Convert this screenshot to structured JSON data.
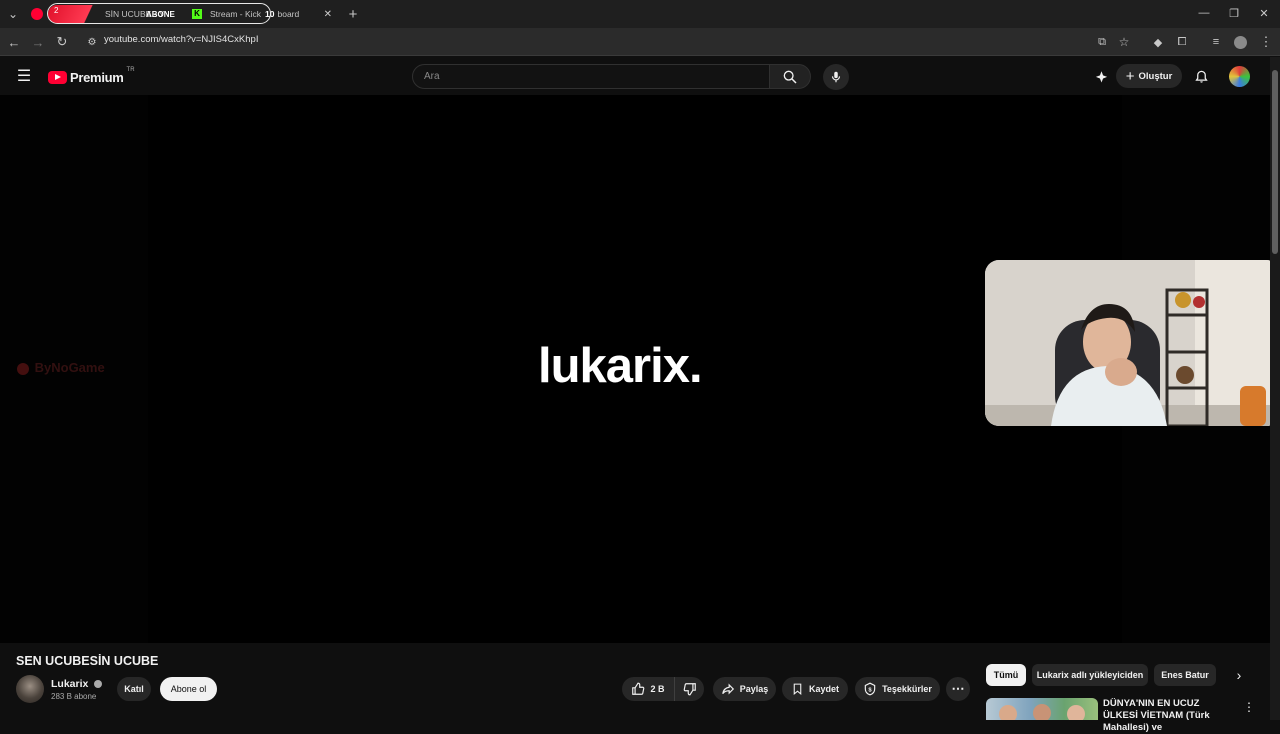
{
  "browser": {
    "tabs": [
      {
        "label": "SİN UCUBE - Y",
        "badge": "2",
        "overlay_text": "ABONE"
      },
      {
        "label": "Stream - Kick",
        "overlay_badge": "10",
        "label_tail": "board"
      }
    ],
    "url": "youtube.com/watch?v=NJIS4CxKhpI"
  },
  "youtube": {
    "logo_text": "Premium",
    "region": "TR",
    "search_placeholder": "Ara",
    "create_label": "Oluştur"
  },
  "player": {
    "center_text": "lukarix.",
    "watermark": "ByNoGame"
  },
  "video": {
    "title": "SEN UCUBESİN UCUBE",
    "channel": "Lukarix",
    "subscribers": "283 B abone",
    "join_label": "Katıl",
    "subscribe_label": "Abone ol",
    "likes": "2 B",
    "share_label": "Paylaş",
    "save_label": "Kaydet",
    "thanks_label": "Teşekkürler"
  },
  "recommendations": {
    "chips": [
      "Tümü",
      "Lukarix adlı yükleyiciden",
      "Enes Batur"
    ],
    "first_title": "DÜNYA'NIN EN UCUZ ÜLKESİ VİETNAM (Türk Mahallesi) ve"
  },
  "colors": {
    "youtube_red": "#ff0033",
    "kick_green": "#53fc18"
  }
}
